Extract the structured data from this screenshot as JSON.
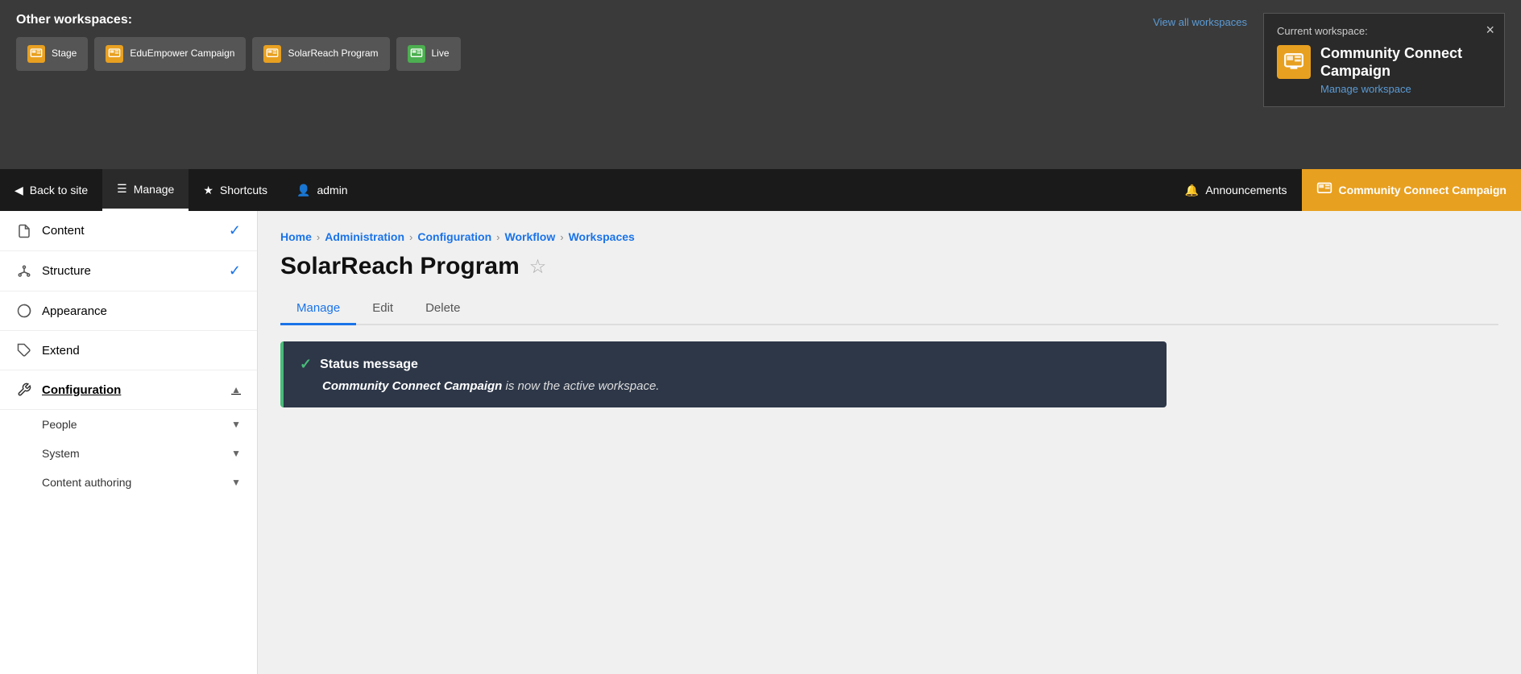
{
  "workspace_overlay": {
    "title": "Other workspaces:",
    "view_all_label": "View all workspaces",
    "close_label": "×",
    "workspaces": [
      {
        "id": "stage",
        "label": "Stage",
        "icon_type": "orange"
      },
      {
        "id": "eduempower",
        "label": "EduEmpower Campaign",
        "icon_type": "orange"
      },
      {
        "id": "solarreach",
        "label": "SolarReach Program",
        "icon_type": "orange"
      },
      {
        "id": "live",
        "label": "Live",
        "icon_type": "green"
      }
    ],
    "current": {
      "title_label": "Current workspace:",
      "name": "Community Connect Campaign",
      "manage_link": "Manage workspace",
      "icon_type": "orange"
    }
  },
  "toolbar": {
    "back_label": "Back to site",
    "manage_label": "Manage",
    "shortcuts_label": "Shortcuts",
    "admin_label": "admin",
    "announcements_label": "Announcements",
    "workspace_label": "Community Connect Campaign"
  },
  "sidebar": {
    "items": [
      {
        "id": "content",
        "label": "Content",
        "icon": "doc",
        "has_chevron": true,
        "chevron_type": "blue-circle-down"
      },
      {
        "id": "structure",
        "label": "Structure",
        "icon": "structure",
        "has_chevron": true,
        "chevron_type": "blue-circle-down"
      },
      {
        "id": "appearance",
        "label": "Appearance",
        "icon": "palette",
        "has_chevron": false
      },
      {
        "id": "extend",
        "label": "Extend",
        "icon": "puzzle",
        "has_chevron": false
      },
      {
        "id": "configuration",
        "label": "Configuration",
        "icon": "wrench",
        "has_chevron": true,
        "chevron_type": "up",
        "active": true
      },
      {
        "id": "people",
        "label": "People",
        "icon": "person",
        "has_chevron": true,
        "chevron_type": "down"
      },
      {
        "id": "system",
        "label": "System",
        "icon": null,
        "has_chevron": true,
        "chevron_type": "down"
      },
      {
        "id": "content_authoring",
        "label": "Content authoring",
        "icon": null,
        "has_chevron": true,
        "chevron_type": "down"
      }
    ]
  },
  "breadcrumb": {
    "items": [
      "Home",
      "Administration",
      "Configuration",
      "Workflow",
      "Workspaces"
    ]
  },
  "page": {
    "title": "SolarReach Program",
    "tabs": [
      {
        "id": "manage",
        "label": "Manage",
        "active": true
      },
      {
        "id": "edit",
        "label": "Edit",
        "active": false
      },
      {
        "id": "delete",
        "label": "Delete",
        "active": false
      }
    ]
  },
  "status": {
    "title": "Status message",
    "body_italic": "Community Connect Campaign",
    "body_rest": " is now the active workspace."
  }
}
